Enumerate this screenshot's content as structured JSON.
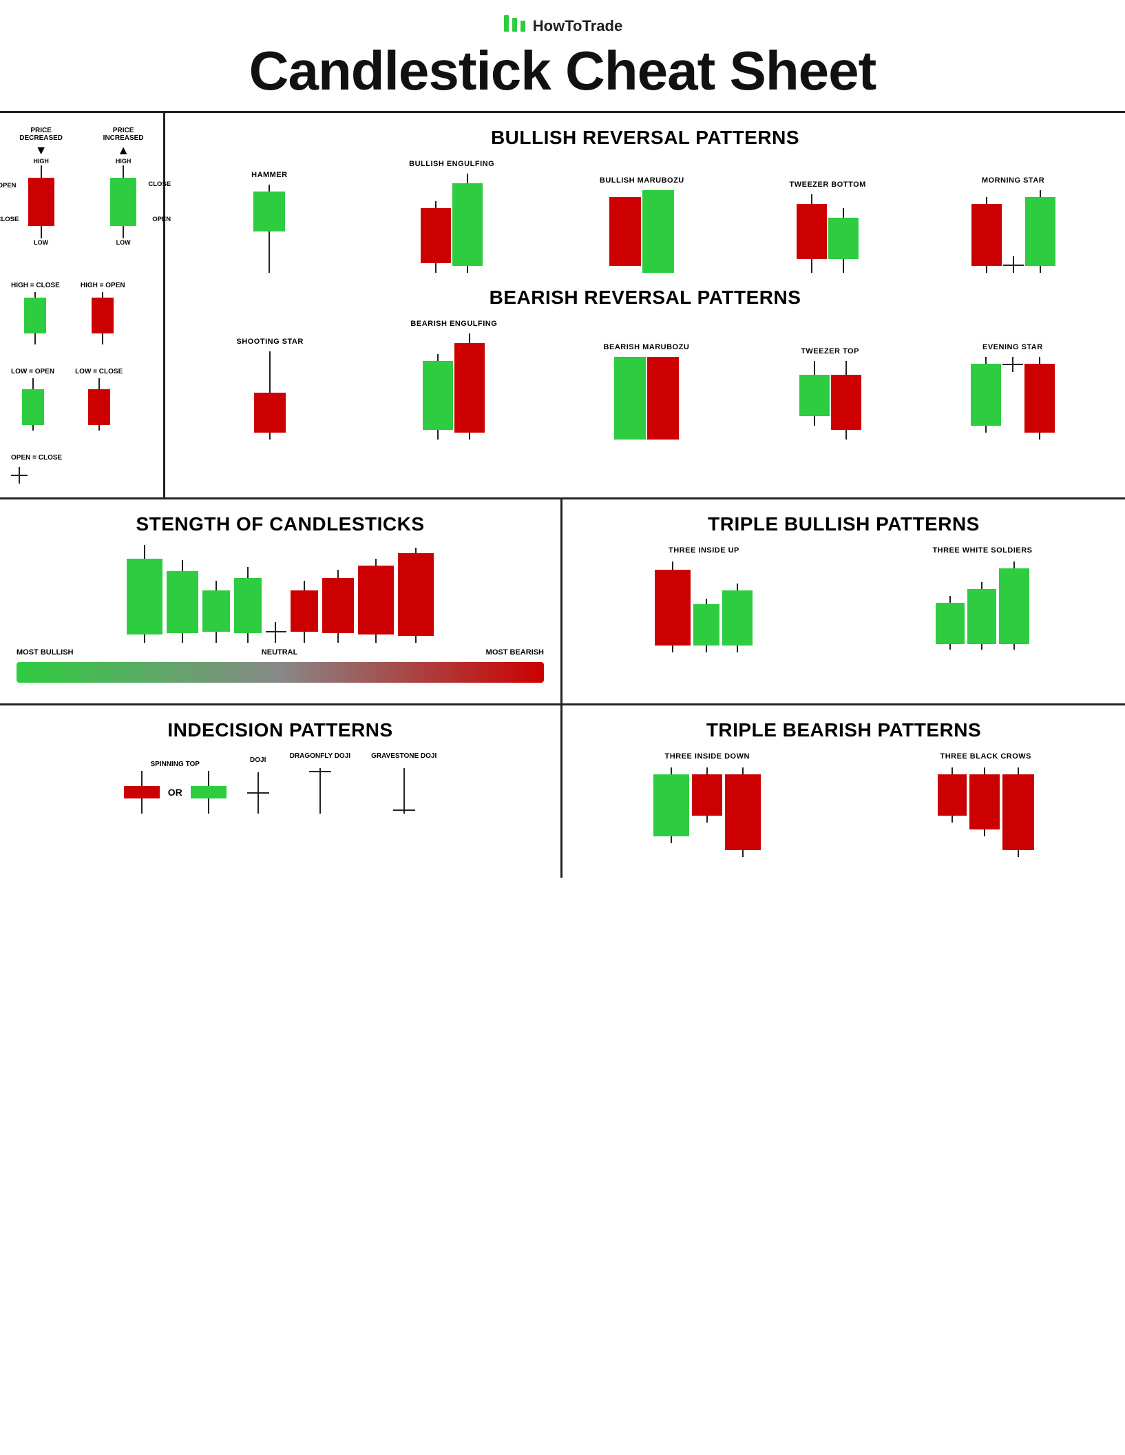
{
  "logo": {
    "icon": "|||",
    "text": "HowToTrade"
  },
  "title": "Candlestick Cheat Sheet",
  "sections": {
    "bullish_reversal": {
      "title": "BULLISH REVERSAL PATTERNS",
      "patterns": [
        {
          "name": "HAMMER"
        },
        {
          "name": "BULLISH ENGULFING"
        },
        {
          "name": "BULLISH MARUBOZU"
        },
        {
          "name": "TWEEZER BOTTOM"
        },
        {
          "name": "MORNING STAR"
        }
      ]
    },
    "bearish_reversal": {
      "title": "BEARISH REVERSAL PATTERNS",
      "patterns": [
        {
          "name": "SHOOTING STAR"
        },
        {
          "name": "BEARISH ENGULFING"
        },
        {
          "name": "BEARISH MARUBOZU"
        },
        {
          "name": "TWEEZER TOP"
        },
        {
          "name": "EVENING STAR"
        }
      ]
    },
    "strength": {
      "title": "STENGTH OF CANDLESTICKS",
      "labels": {
        "left": "MOST BULLISH",
        "center": "NEUTRAL",
        "right": "MOST BEARISH"
      }
    },
    "indecision": {
      "title": "INDECISION PATTERNS",
      "patterns": [
        {
          "name": "SPINNING TOP"
        },
        {
          "name": "DOJI"
        },
        {
          "name": "DRAGONFLY DOJI"
        },
        {
          "name": "GRAVESTONE DOJI"
        }
      ],
      "or_label": "OR"
    },
    "triple_bullish": {
      "title": "TRIPLE BULLISH PATTERNS",
      "patterns": [
        {
          "name": "THREE INSIDE UP"
        },
        {
          "name": "THREE WHITE SOLDIERS"
        }
      ]
    },
    "triple_bearish": {
      "title": "TRIPLE BEARISH PATTERNS",
      "patterns": [
        {
          "name": "THREE INSIDE DOWN"
        },
        {
          "name": "THREE BLACK CROWS"
        }
      ]
    }
  },
  "legend": {
    "price_decreased": "PRICE DECREASED",
    "price_increased": "PRICE INCREASED",
    "high": "HIGH",
    "low": "LOW",
    "open": "OPEN",
    "close": "CLOSE",
    "high_eq_close": "HIGH = CLOSE",
    "high_eq_open": "HIGH = OPEN",
    "low_eq_open": "LOW = OPEN",
    "low_eq_close": "LOW = CLOSE",
    "open_eq_close": "OPEN = CLOSE"
  },
  "colors": {
    "green": "#2ecc40",
    "red": "#cc0000",
    "black": "#111111",
    "accent_green": "#00b300"
  }
}
